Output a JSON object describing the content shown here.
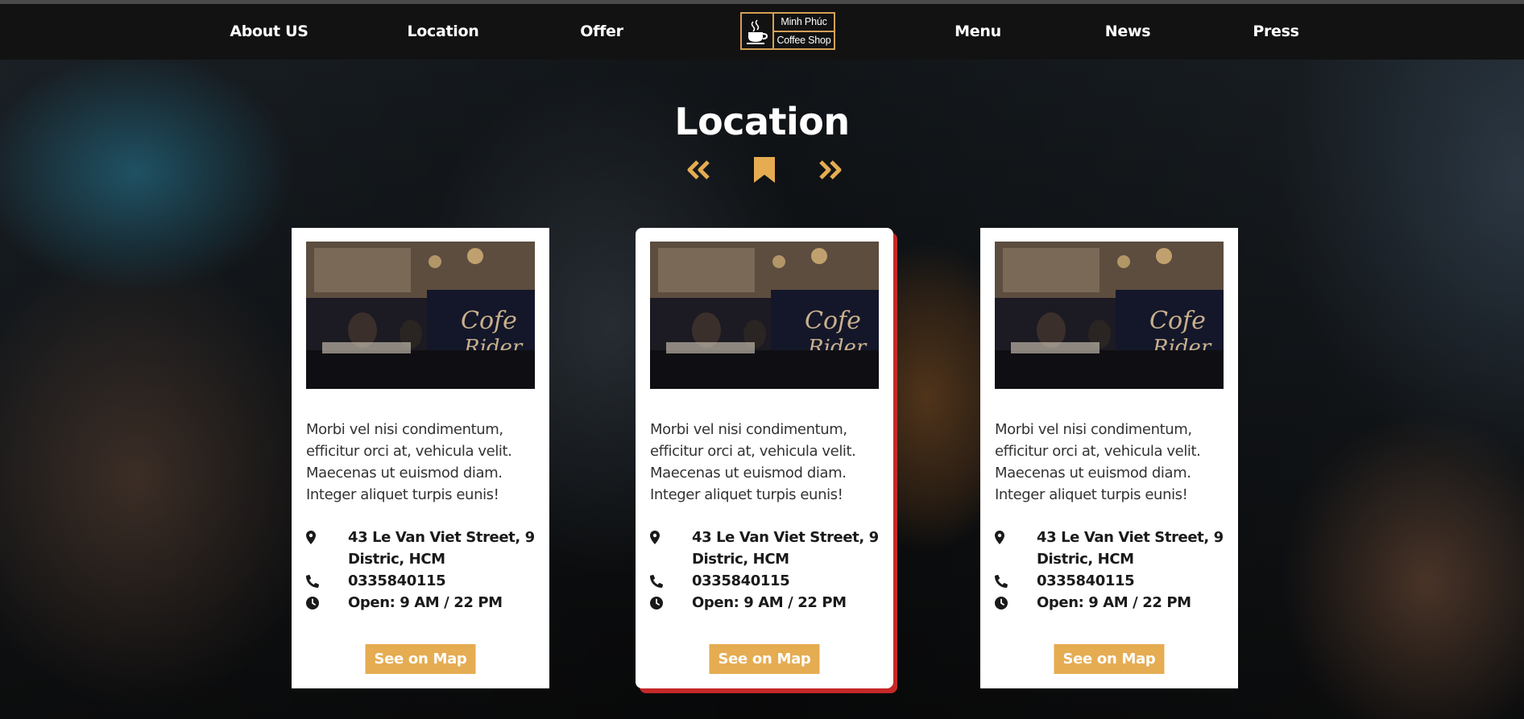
{
  "nav": {
    "links": [
      "About US",
      "Location",
      "Offer",
      "Menu",
      "News",
      "Press"
    ],
    "logo": {
      "line1": "Minh Phúc",
      "line2": "Coffee Shop"
    }
  },
  "section": {
    "title": "Location"
  },
  "colors": {
    "accent": "#e5ac52",
    "active_shadow": "#c62828",
    "nav_bg": "#121212"
  },
  "cards": [
    {
      "description": "Morbi vel nisi condimentum, efficitur orci at, vehicula velit. Maecenas ut euismod diam. Integer aliquet turpis eunis!",
      "address": "43 Le Van Viet Street, 9 Distric, HCM",
      "phone": "0335840115",
      "hours": "Open: 9 AM / 22 PM",
      "button": "See on Map"
    },
    {
      "description": "Morbi vel nisi condimentum, efficitur orci at, vehicula velit. Maecenas ut euismod diam. Integer aliquet turpis eunis!",
      "address": "43 Le Van Viet Street, 9 Distric, HCM",
      "phone": "0335840115",
      "hours": "Open: 9 AM / 22 PM",
      "button": "See on Map"
    },
    {
      "description": "Morbi vel nisi condimentum, efficitur orci at, vehicula velit. Maecenas ut euismod diam. Integer aliquet turpis eunis!",
      "address": "43 Le Van Viet Street, 9 Distric, HCM",
      "phone": "0335840115",
      "hours": "Open: 9 AM / 22 PM",
      "button": "See on Map"
    }
  ],
  "icons": [
    "coffee-cup-icon",
    "double-chevron-left-icon",
    "bookmark-icon",
    "double-chevron-right-icon",
    "map-marker-icon",
    "phone-icon",
    "clock-icon"
  ]
}
